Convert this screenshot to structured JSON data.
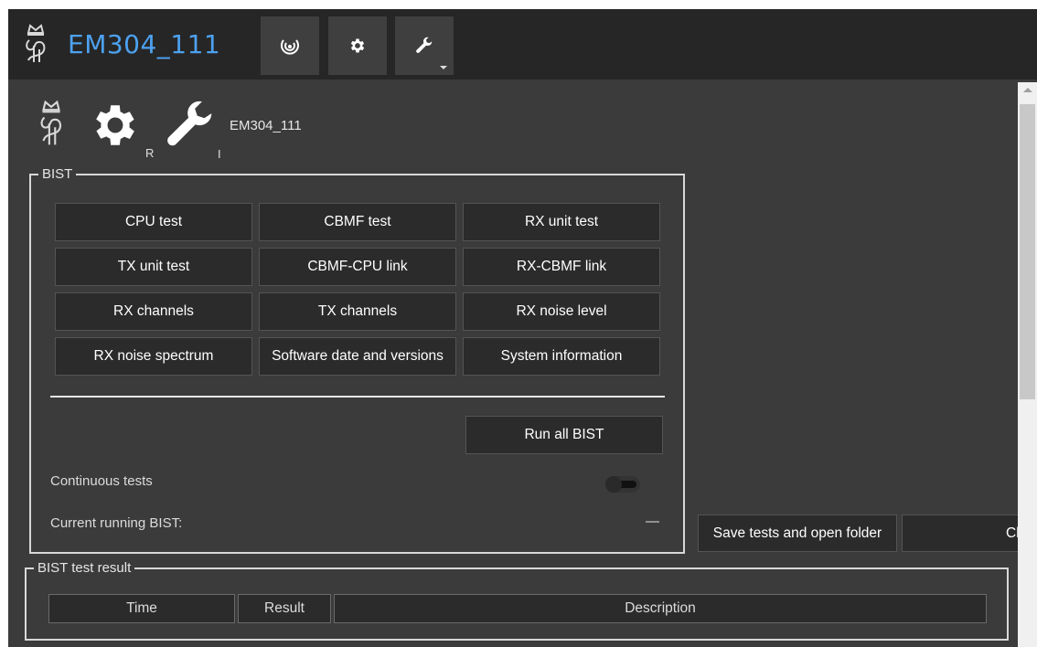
{
  "app": {
    "title": "EM304_111"
  },
  "toolbar": {
    "buttons": [
      {
        "icon": "sonar-icon"
      },
      {
        "icon": "gear-icon"
      },
      {
        "icon": "wrench-icon"
      }
    ]
  },
  "header": {
    "name": "EM304_111",
    "gear_sub": "R",
    "wrench_sub": "I"
  },
  "bist": {
    "legend": "BIST",
    "tests": [
      "CPU test",
      "CBMF test",
      "RX unit test",
      "TX unit test",
      "CBMF-CPU link",
      "RX-CBMF link",
      "RX channels",
      "TX channels",
      "RX noise level",
      "RX noise spectrum",
      "Software date and versions",
      "System information"
    ],
    "run_all_label": "Run all BIST",
    "continuous_label": "Continuous tests",
    "current_label": "Current running BIST:",
    "current_value": "—"
  },
  "actions": {
    "save_label": "Save tests and open folder",
    "clear_label": "Clea"
  },
  "result": {
    "legend": "BIST test result",
    "columns": [
      "Time",
      "Result",
      "Description"
    ]
  }
}
